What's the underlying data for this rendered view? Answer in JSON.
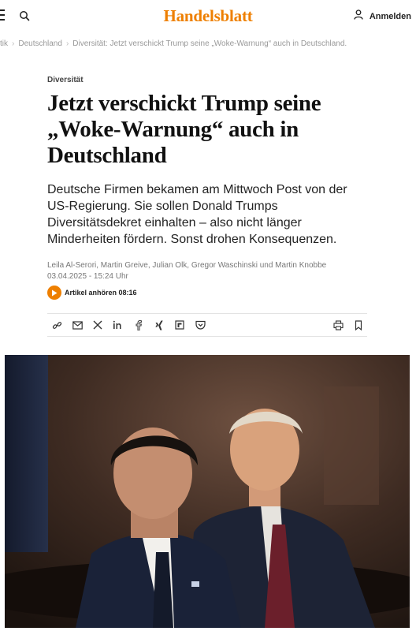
{
  "header": {
    "logo_text": "Handelsblatt",
    "login_label": "Anmelden",
    "brand_color": "#ee7f00",
    "icons": [
      "menu-icon",
      "search-icon",
      "user-icon"
    ]
  },
  "breadcrumb": {
    "items": [
      "tik",
      "Deutschland",
      "Diversität: Jetzt verschickt Trump seine „Woke-Warnung“ auch in Deutschland."
    ]
  },
  "article": {
    "kicker": "Diversität",
    "headline": "Jetzt verschickt Trump seine „Woke-Warnung“ auch in Deutschland",
    "lead": "Deutsche Firmen bekamen am Mittwoch Post von der US-Regierung. Sie sollen Donald Trumps Diversitätsdekret einhalten – also nicht länger Minderheiten fördern. Sonst drohen Konsequenzen.",
    "authors": "Leila Al-Serori, Martin Greive, Julian Olk, Gregor Waschinski und Martin Knobbe",
    "date": "03.04.2025 - 15:24 Uhr",
    "audio_label": "Artikel anhören 08:16"
  },
  "share_bar": {
    "icons": [
      "link-icon",
      "mail-icon",
      "x-icon",
      "linkedin-icon",
      "facebook-icon",
      "xing-icon",
      "flipboard-icon",
      "pocket-icon",
      "print-icon",
      "bookmark-icon"
    ]
  }
}
